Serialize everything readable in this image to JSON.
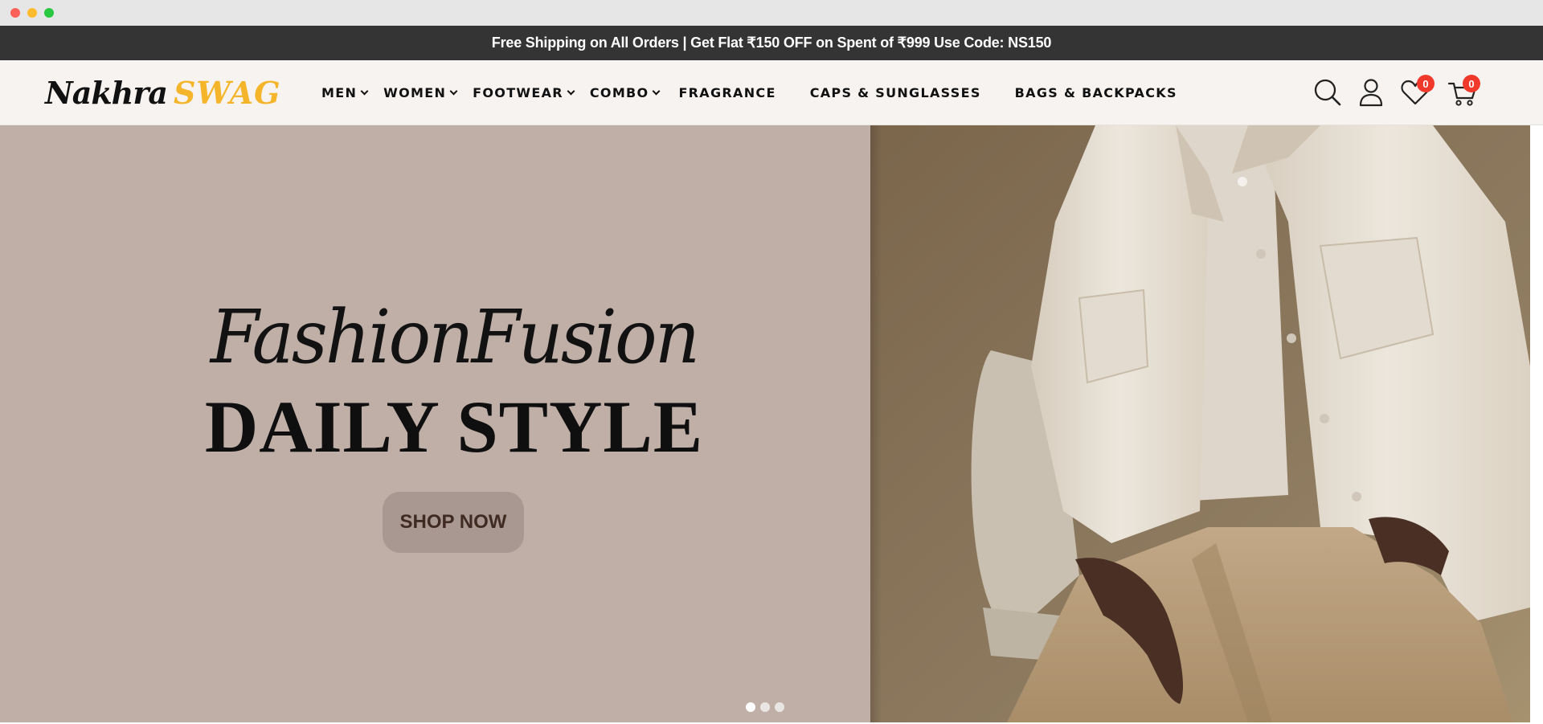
{
  "announcement": "Free Shipping on All Orders | Get Flat ₹150 OFF on Spent of ₹999 Use Code: NS150",
  "logo": {
    "part1": "Nakhra",
    "part2": "SWAG"
  },
  "nav": [
    {
      "label": "MEN",
      "dropdown": true
    },
    {
      "label": "WOMEN",
      "dropdown": true
    },
    {
      "label": "FOOTWEAR",
      "dropdown": true
    },
    {
      "label": "COMBO",
      "dropdown": true
    },
    {
      "label": "FRAGRANCE",
      "dropdown": false
    },
    {
      "label": "CAPS & SUNGLASSES",
      "dropdown": false
    },
    {
      "label": "BAGS & BACKPACKS",
      "dropdown": false
    }
  ],
  "icons": {
    "search": "search-icon",
    "account": "user-icon",
    "wishlist": "heart-icon",
    "cart": "cart-icon"
  },
  "counts": {
    "wishlist": "0",
    "cart": "0"
  },
  "hero": {
    "script_title": "FashionFusion",
    "title": "DAILY STYLE",
    "button": "SHOP NOW",
    "slides": 3,
    "active_slide": 1
  },
  "colors": {
    "announcement_bg": "#343434",
    "header_bg": "#f7f3f0",
    "logo_accent": "#f5b52a",
    "hero_left_bg": "#c0afa7",
    "badge": "#f0392b"
  }
}
